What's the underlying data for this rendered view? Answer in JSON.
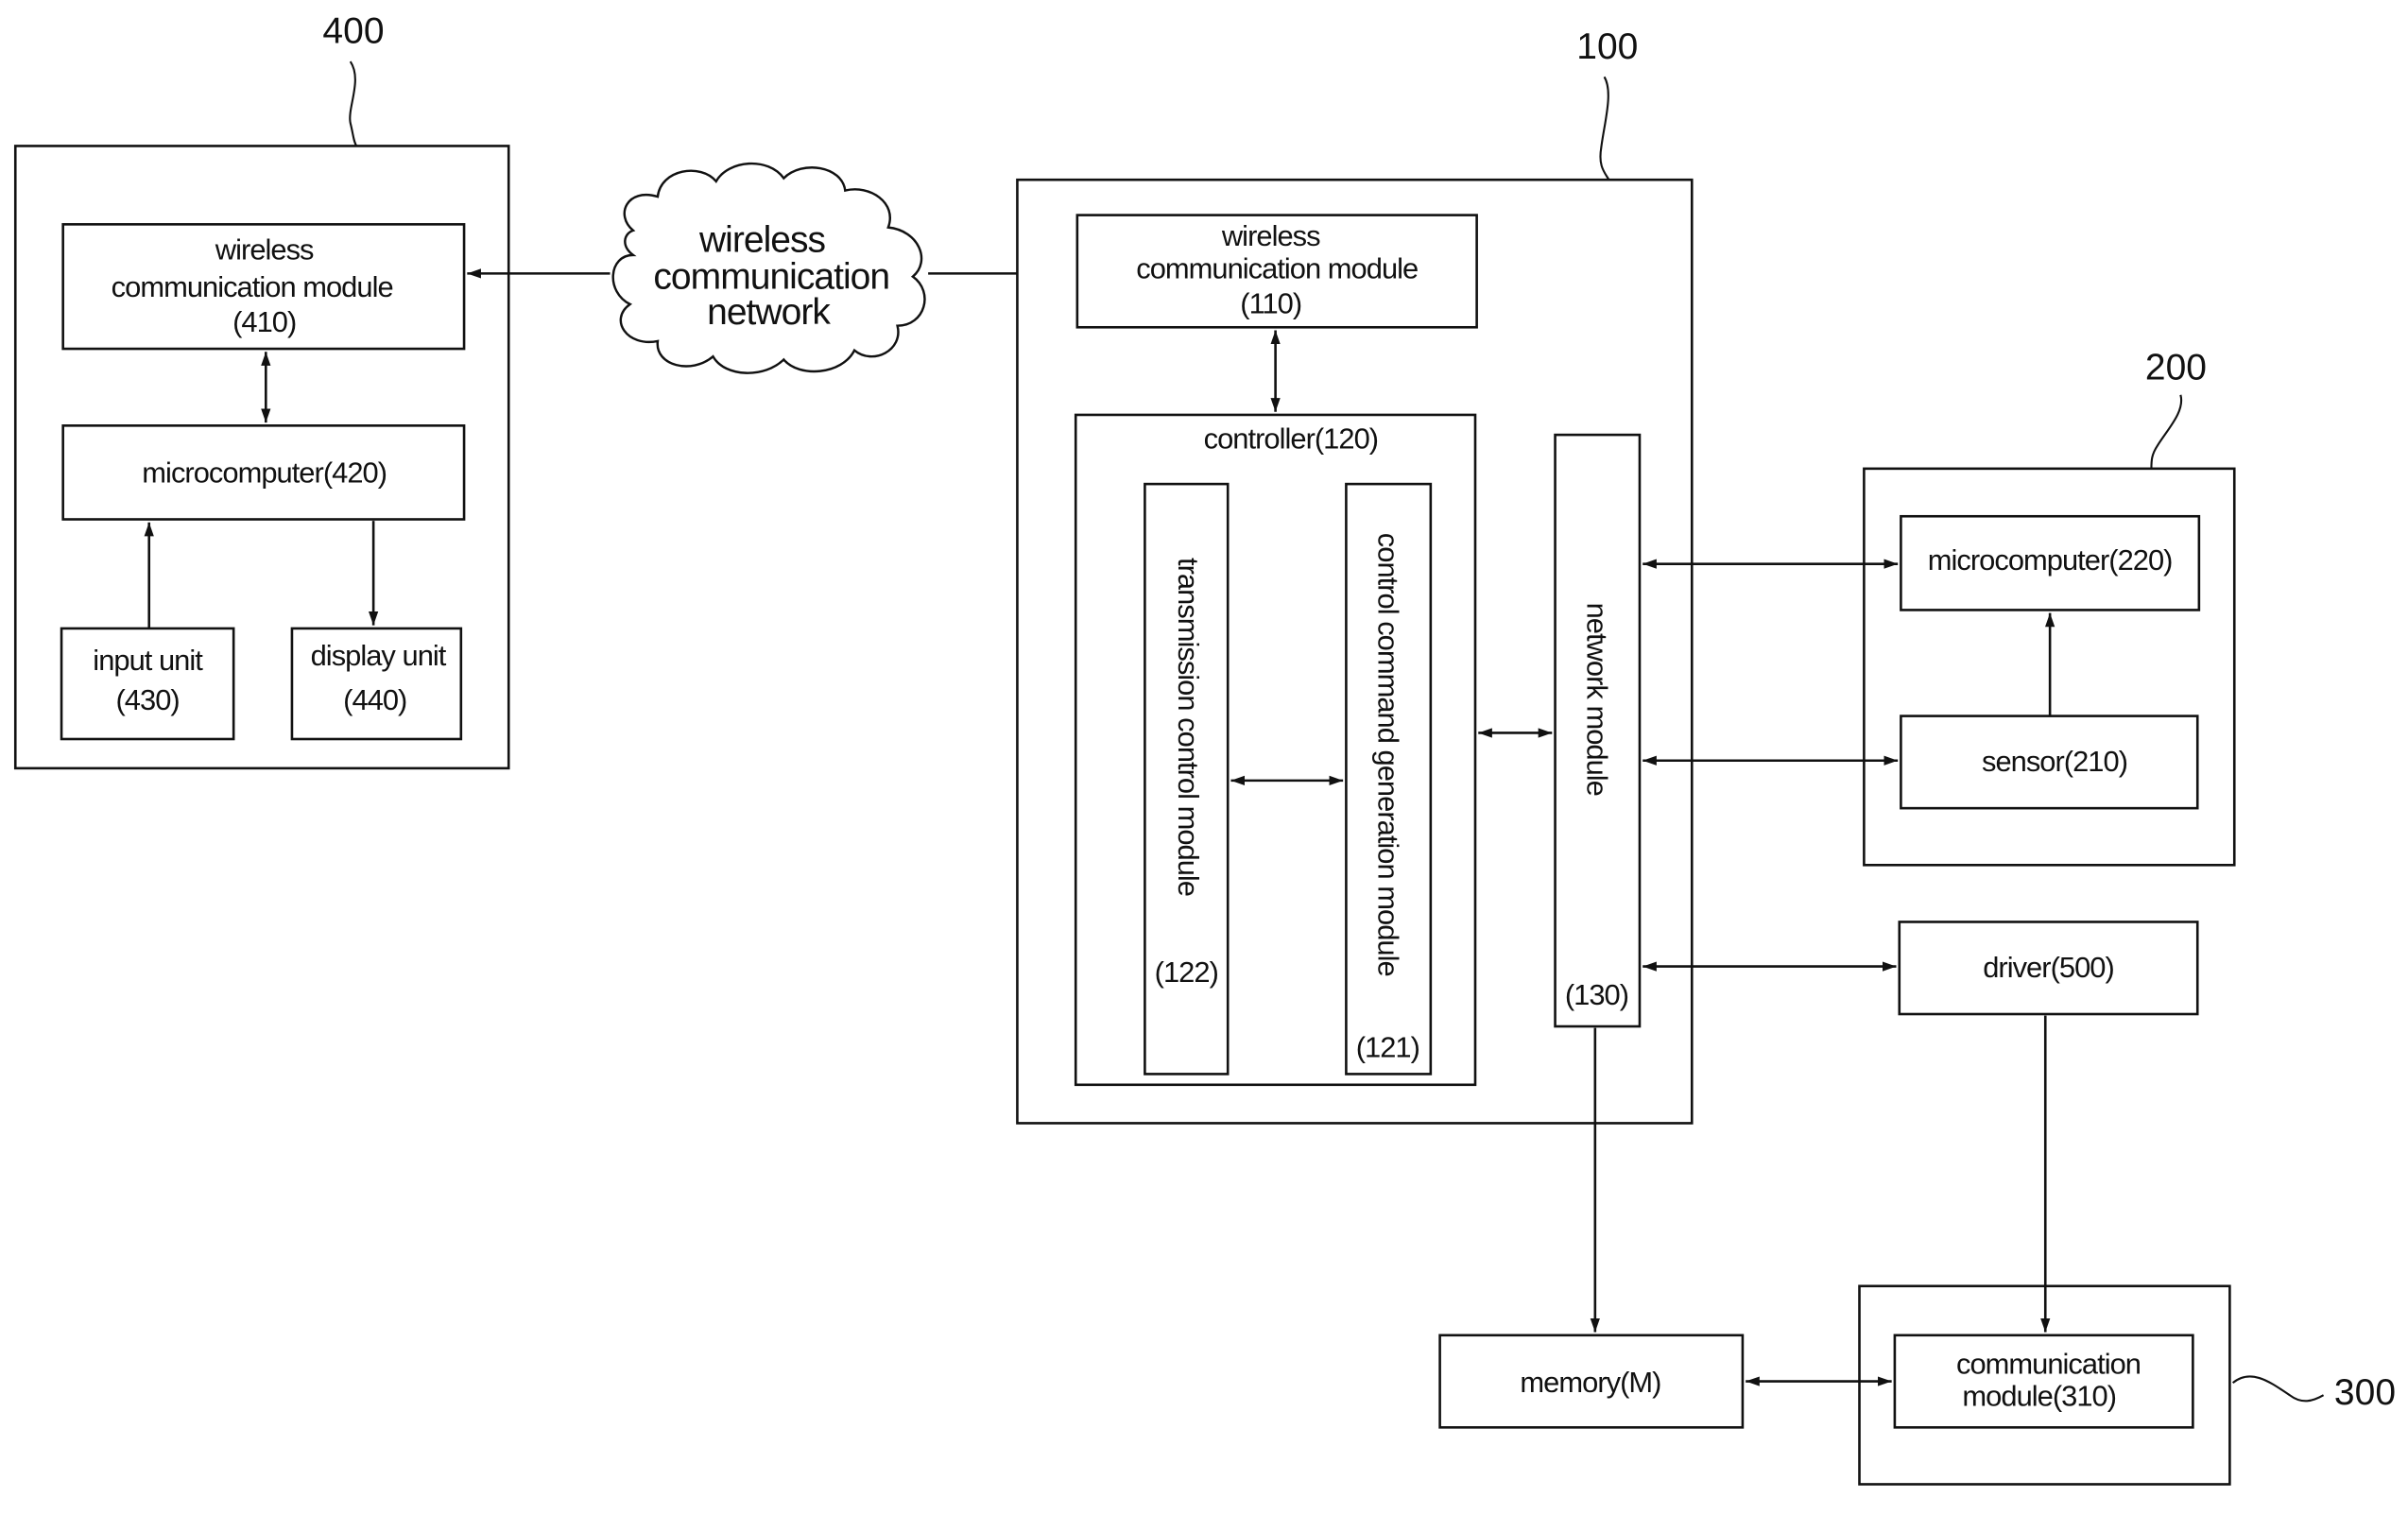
{
  "diagram": {
    "reference_labels": {
      "r400": "400",
      "r100": "100",
      "r200": "200",
      "r300": "300"
    },
    "cloud": {
      "lines": [
        "wireless",
        "communication",
        "network"
      ]
    },
    "device_400": {
      "wireless_module": [
        "wireless",
        "communication module",
        "(410)"
      ],
      "microcomputer": "microcomputer(420)",
      "input_unit": [
        "input unit",
        "(430)"
      ],
      "display_unit": [
        "display unit",
        "(440)"
      ]
    },
    "device_100": {
      "wireless_module": [
        "wireless",
        "communication module",
        "(110)"
      ],
      "controller": "controller(120)",
      "transmission_control": "transmission control module",
      "transmission_control_ref": "(122)",
      "control_command": "control command generation module",
      "control_command_ref": "(121)",
      "network_module": "network module",
      "network_module_ref": "(130)"
    },
    "device_200": {
      "microcomputer": "microcomputer(220)",
      "sensor": "sensor(210)"
    },
    "driver": "driver(500)",
    "memory": "memory(M)",
    "device_300": {
      "communication_module": [
        "communication",
        "module(310)"
      ]
    }
  }
}
